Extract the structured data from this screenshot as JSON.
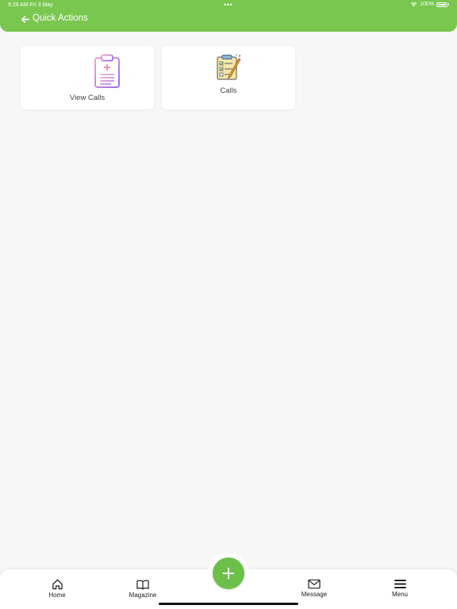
{
  "status_bar": {
    "time": "9:29 AM   Fri 3 May",
    "dots": "•••",
    "battery": "100%"
  },
  "header": {
    "title": "Quick Actions",
    "back_icon": "arrow-left-icon"
  },
  "actions": [
    {
      "label": "View Calls",
      "icon": "clipboard-icon"
    },
    {
      "label": "Calls",
      "icon": "checklist-pencil-icon"
    }
  ],
  "bottom_nav": {
    "items": [
      {
        "label": "Home",
        "icon": "home-icon"
      },
      {
        "label": "Magazine",
        "icon": "book-icon"
      },
      {
        "label": "Message",
        "icon": "envelope-icon"
      },
      {
        "label": "Menu",
        "icon": "hamburger-icon"
      }
    ],
    "fab_icon": "plus-icon"
  },
  "colors": {
    "header": "#7ac74f",
    "fab": "#6cc04a",
    "background": "#f7f7f7"
  }
}
